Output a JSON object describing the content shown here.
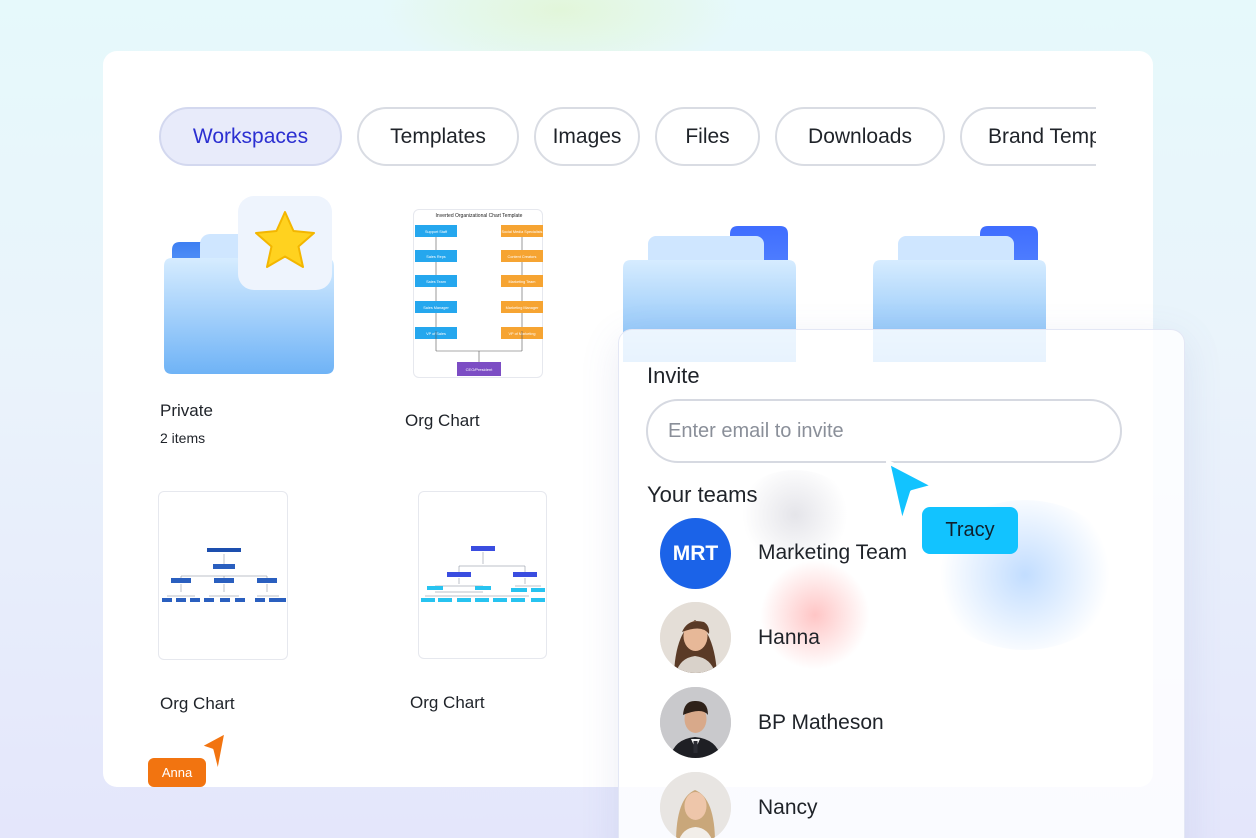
{
  "tabs": [
    {
      "label": "Workspaces",
      "active": true
    },
    {
      "label": "Templates"
    },
    {
      "label": "Images"
    },
    {
      "label": "Files"
    },
    {
      "label": "Downloads"
    },
    {
      "label": "Brand Templates"
    }
  ],
  "items": {
    "private": {
      "name": "Private",
      "count": "2 items"
    },
    "org1": {
      "name": "Org Chart"
    },
    "org2": {
      "name": "Org Chart"
    },
    "org3": {
      "name": "Org Chart"
    }
  },
  "org_template": {
    "title": "Inverted Organizational Chart Template",
    "left_column": [
      "Support Staff",
      "Sales Reps",
      "Sales Team",
      "Sales Manager",
      "VP of Sales"
    ],
    "right_column": [
      "Social Media Specialists",
      "Content Creators",
      "Marketing Team",
      "Marketing Manager",
      "VP of Marketing"
    ],
    "bottom": "CEO/President"
  },
  "invite_panel": {
    "title": "Invite",
    "placeholder": "Enter email to invite",
    "teams_heading": "Your teams",
    "members": [
      {
        "name": "Marketing Team",
        "initials": "MRT"
      },
      {
        "name": "Hanna"
      },
      {
        "name": "BP Matheson"
      },
      {
        "name": "Nancy"
      }
    ]
  },
  "cursors": {
    "anna": {
      "label": "Anna",
      "color": "#f27410"
    },
    "tracy": {
      "label": "Tracy",
      "color": "#12c3ff"
    }
  },
  "colors": {
    "active_tab_bg": "#e8ebfa",
    "active_tab_text": "#2b2fd1",
    "team_avatar": "#1b63e8"
  }
}
